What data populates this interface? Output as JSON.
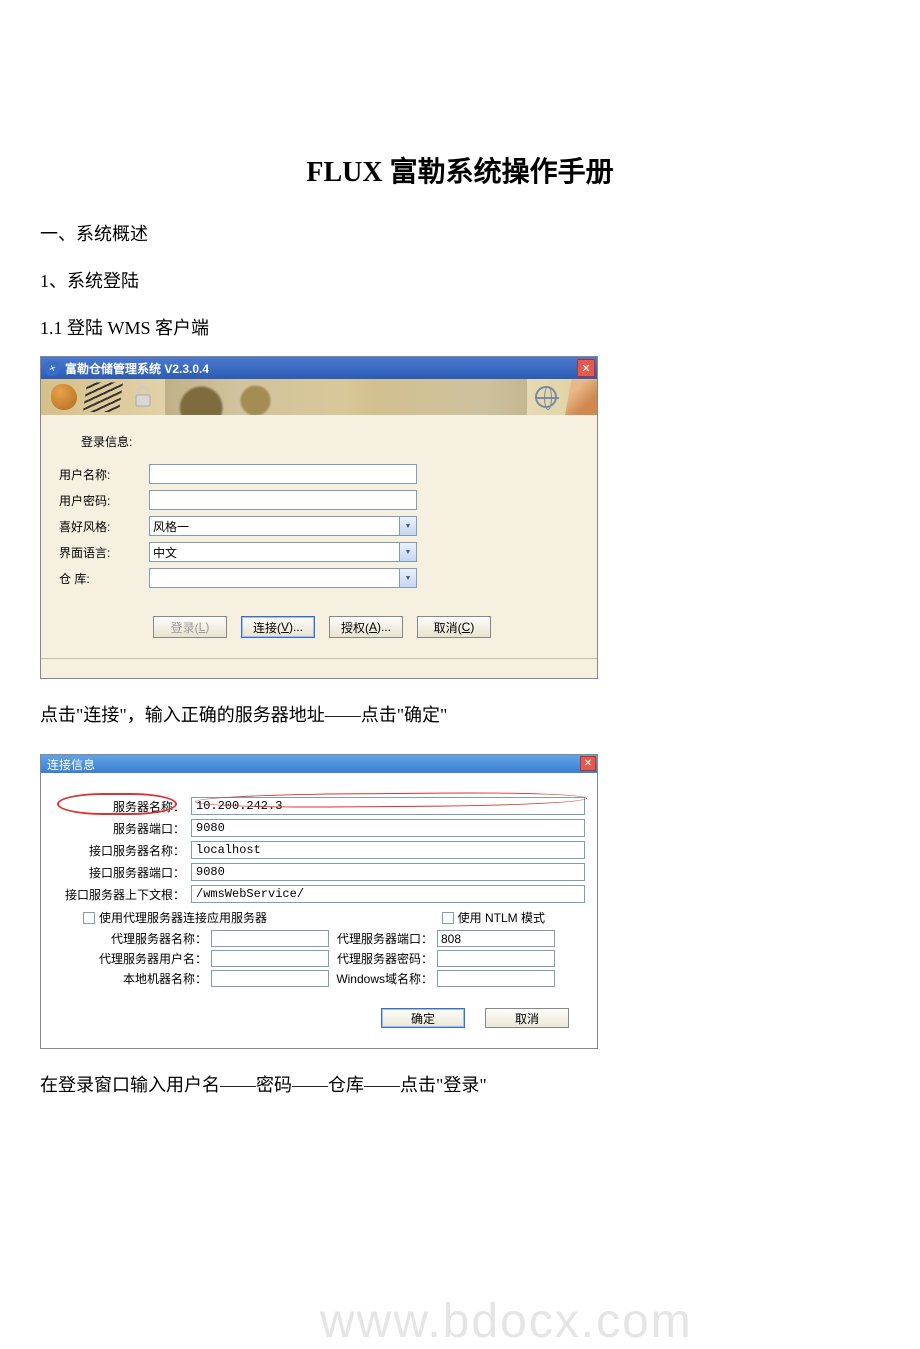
{
  "doc": {
    "title": "FLUX 富勒系统操作手册",
    "section1": "一、系统概述",
    "section1_1": "1、系统登陆",
    "section1_1_1": "1.1 登陆 WMS 客户端",
    "para_after_login": "点击\"连接\"，输入正确的服务器地址——点击\"确定\"",
    "para_after_conn": "在登录窗口输入用户名——密码——仓库——点击\"登录\"",
    "watermark": "www.bdocx.com"
  },
  "login": {
    "window_title": "富勒仓储管理系统 V2.3.0.4",
    "section_label": "登录信息:",
    "fields": {
      "username_label": "用户名称:",
      "username_value": "",
      "password_label": "用户密码:",
      "password_value": "",
      "style_label": "喜好风格:",
      "style_value": "风格一",
      "lang_label": "界面语言:",
      "lang_value": "中文",
      "warehouse_label": "仓      库:",
      "warehouse_value": ""
    },
    "buttons": {
      "login": "登录(L)",
      "connect": "连接(V)...",
      "authorize": "授权(A)...",
      "cancel": "取消(C)"
    }
  },
  "conn": {
    "window_title": "连接信息",
    "rows": {
      "server_name_label": "服务器名称：",
      "server_name_value": "10.200.242.3",
      "server_port_label": "服务器端口：",
      "server_port_value": "9080",
      "iface_name_label": "接口服务器名称：",
      "iface_name_value": "localhost",
      "iface_port_label": "接口服务器端口：",
      "iface_port_value": "9080",
      "iface_ctx_label": "接口服务器上下文根：",
      "iface_ctx_value": "/wmsWebService/"
    },
    "proxy_check_label": "使用代理服务器连接应用服务器",
    "ntlm_check_label": "使用 NTLM 模式",
    "proxy": {
      "name_label": "代理服务器名称：",
      "name_value": "",
      "port_label": "代理服务器端口：",
      "port_value": "808",
      "user_label": "代理服务器用户名：",
      "user_value": "",
      "pwd_label": "代理服务器密码：",
      "pwd_value": "",
      "local_label": "本地机器名称：",
      "local_value": "",
      "domain_label": "Windows域名称：",
      "domain_value": ""
    },
    "buttons": {
      "ok": "确定",
      "cancel": "取消"
    }
  }
}
